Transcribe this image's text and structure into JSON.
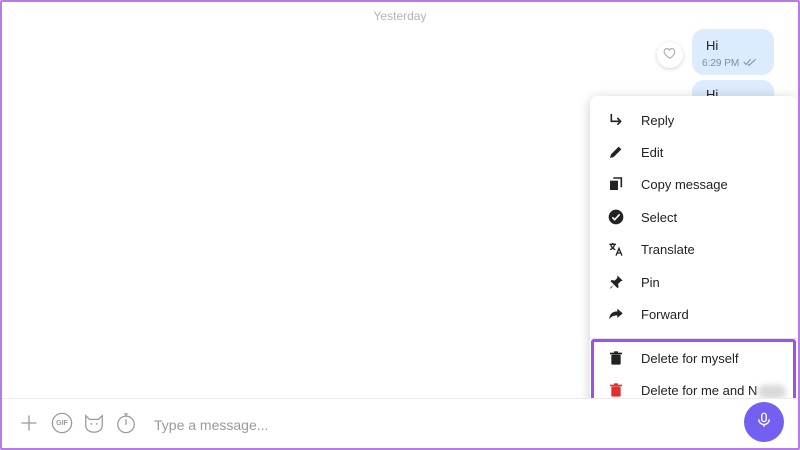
{
  "chat": {
    "date_separator": "Yesterday",
    "messages": [
      {
        "text": "Hi",
        "time": "6:29 PM"
      },
      {
        "text": "Hi"
      }
    ]
  },
  "context_menu": {
    "items": [
      {
        "label": "Reply",
        "icon": "reply-icon"
      },
      {
        "label": "Edit",
        "icon": "pencil-icon"
      },
      {
        "label": "Copy message",
        "icon": "copy-icon"
      },
      {
        "label": "Select",
        "icon": "check-circle-icon"
      },
      {
        "label": "Translate",
        "icon": "translate-icon"
      },
      {
        "label": "Pin",
        "icon": "pin-icon"
      },
      {
        "label": "Forward",
        "icon": "forward-icon"
      },
      {
        "label": "Delete for myself",
        "icon": "trash-icon"
      },
      {
        "label": "Delete for me and N",
        "icon": "trash-red-icon"
      }
    ],
    "highlight_color": "#a64ee3",
    "danger_color": "#e03131"
  },
  "composer": {
    "placeholder": "Type a message...",
    "gif_label": "GIF",
    "accent_color": "#7360f2"
  }
}
